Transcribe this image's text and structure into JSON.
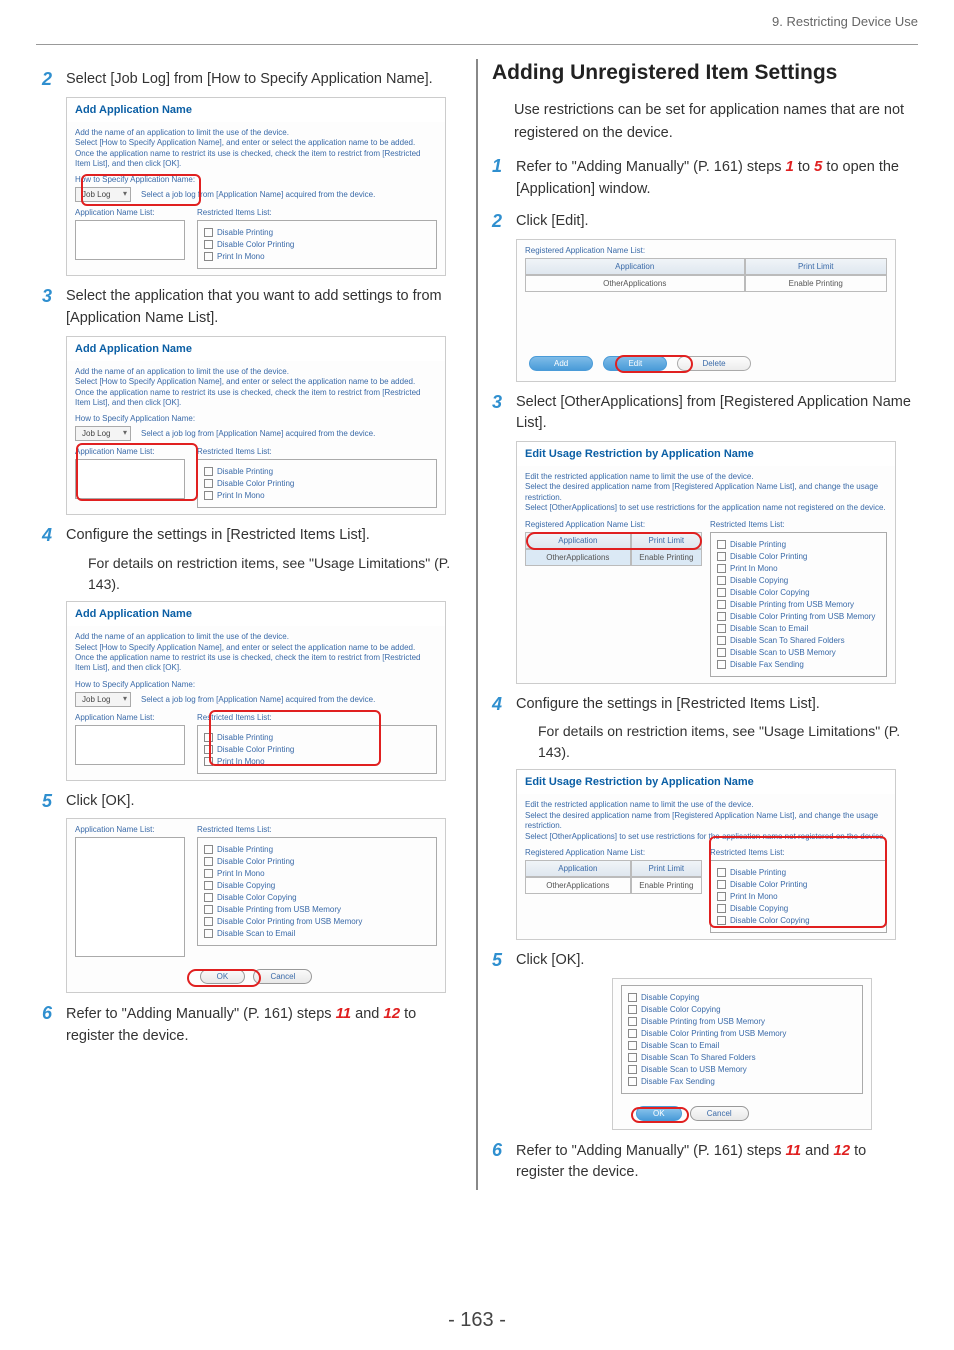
{
  "chapter_header": "9. Restricting Device Use",
  "page_number": "- 163 -",
  "left": {
    "step2": {
      "num": "2",
      "text": "Select [Job Log] from [How to Specify Application Name]."
    },
    "ss_add_app": {
      "title": "Add Application Name",
      "desc": "Add the name of an application to limit the use of the device.\nSelect [How to Specify Application Name], and enter or select the application name to be added.\nOnce the application name to restrict its use is checked, check the item to restrict from [Restricted Item List], and then click [OK].",
      "how_label": "How to Specify Application Name:",
      "joblog": "Job Log",
      "joblog_hint": "Select a job log from [Application Name] acquired from the device.",
      "app_list_label": "Application Name List:",
      "restricted_label": "Restricted Items List:",
      "items": [
        "Disable Printing",
        "Disable Color Printing",
        "Print In Mono"
      ]
    },
    "step3": {
      "num": "3",
      "text": "Select the application that you want to add settings to from [Application Name List]."
    },
    "step4": {
      "num": "4",
      "text": "Configure the settings in [Restricted Items List]."
    },
    "details_text": "For details on restriction items, see \"Usage Limitations\" (P. 143).",
    "step5": {
      "num": "5",
      "text": "Click [OK]."
    },
    "ss_ok_items": [
      "Disable Printing",
      "Disable Color Printing",
      "Print In Mono",
      "Disable Copying",
      "Disable Color Copying",
      "Disable Printing from USB Memory",
      "Disable Color Printing from USB Memory",
      "Disable Scan to Email"
    ],
    "ok_btn": "OK",
    "cancel_btn": "Cancel",
    "step6": {
      "num": "6",
      "pre": "Refer to \"Adding Manually\" (P. 161) steps ",
      "s11": "11",
      "mid": " and ",
      "s12": "12",
      "post": " to register the device."
    }
  },
  "right": {
    "title": "Adding Unregistered Item Settings",
    "intro": "Use restrictions can be set for application names that are not registered on the device.",
    "step1": {
      "num": "1",
      "pre": "Refer to \"Adding Manually\" (P. 161) steps ",
      "s1": "1",
      "mid": " to ",
      "s5": "5",
      "post": " to open the [Application] window."
    },
    "step2": {
      "num": "2",
      "text": "Click [Edit]."
    },
    "ss_reg": {
      "label": "Registered Application Name List:",
      "col_app": "Application",
      "col_lim": "Print Limit",
      "row_app": "OtherApplications",
      "row_lim": "Enable Printing",
      "btn_add": "Add",
      "btn_edit": "Edit",
      "btn_delete": "Delete"
    },
    "step3": {
      "num": "3",
      "text": "Select [OtherApplications] from [Registered Application Name List]."
    },
    "ss_edit": {
      "title": "Edit Usage Restriction by Application Name",
      "desc": "Edit the restricted application name to limit the use of the device.\nSelect the desired application name from [Registered Application Name List], and change the usage restriction.\nSelect [OtherApplications] to set use restrictions for the application name not registered on the device.",
      "reg_label": "Registered Application Name List:",
      "restricted_label": "Restricted Items List:",
      "col_app": "Application",
      "col_lim": "Print Limit",
      "row_app": "OtherApplications",
      "row_lim": "Enable Printing",
      "items_a": [
        "Disable Printing",
        "Disable Color Printing",
        "Print In Mono",
        "Disable Copying",
        "Disable Color Copying",
        "Disable Printing from USB Memory",
        "Disable Color Printing from USB Memory",
        "Disable Scan to Email",
        "Disable Scan To Shared Folders",
        "Disable Scan to USB Memory",
        "Disable Fax Sending"
      ],
      "items_b": [
        "Disable Printing",
        "Disable Color Printing",
        "Print In Mono",
        "Disable Copying",
        "Disable Color Copying"
      ]
    },
    "step4": {
      "num": "4",
      "text": "Configure the settings in [Restricted Items List]."
    },
    "details_text": "For details on restriction items, see \"Usage Limitations\" (P. 143).",
    "step5": {
      "num": "5",
      "text": "Click [OK]."
    },
    "ss_ok_items": [
      "Disable Copying",
      "Disable Color Copying",
      "Disable Printing from USB Memory",
      "Disable Color Printing from USB Memory",
      "Disable Scan to Email",
      "Disable Scan To Shared Folders",
      "Disable Scan to USB Memory",
      "Disable Fax Sending"
    ],
    "ok_btn": "OK",
    "cancel_btn": "Cancel",
    "step6": {
      "num": "6",
      "pre": "Refer to \"Adding Manually\" (P. 161) steps ",
      "s11": "11",
      "mid": " and ",
      "s12": "12",
      "post": " to register the device."
    }
  }
}
